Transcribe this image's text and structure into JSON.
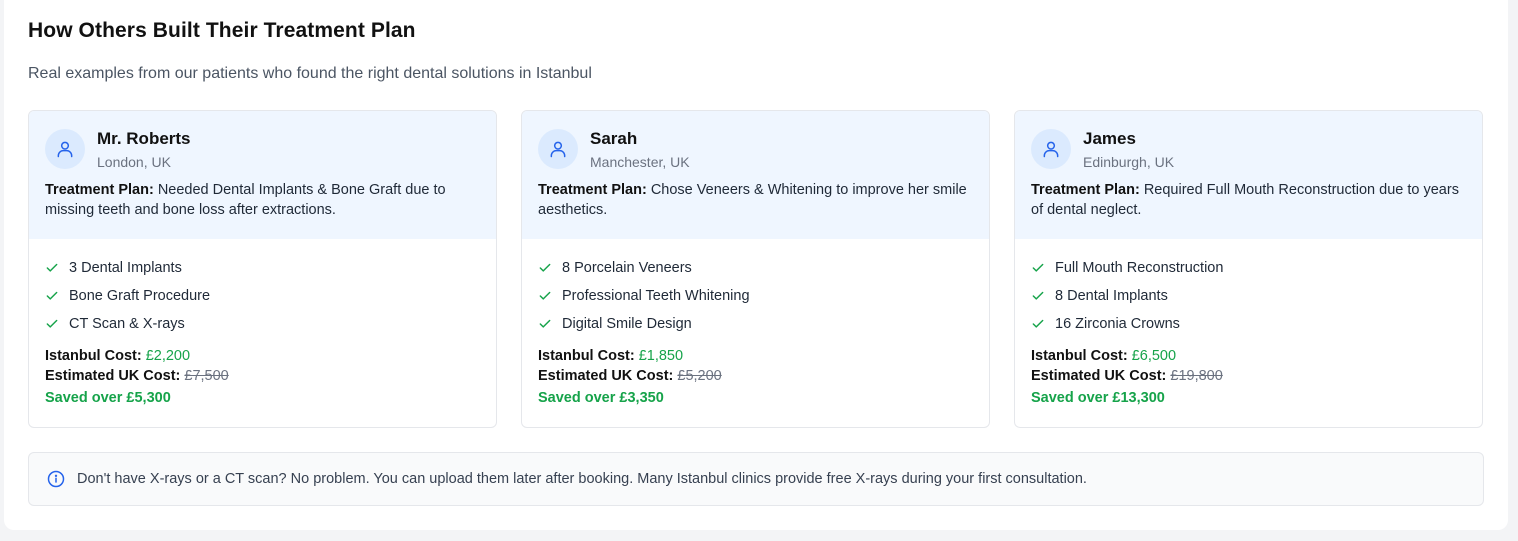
{
  "section": {
    "title": "How Others Built Their Treatment Plan",
    "subtitle": "Real examples from our patients who found the right dental solutions in Istanbul"
  },
  "labels": {
    "plan": "Treatment Plan:",
    "istanbul_cost": "Istanbul Cost:",
    "uk_cost": "Estimated UK Cost:"
  },
  "cards": [
    {
      "name": "Mr. Roberts",
      "location": "London, UK",
      "plan": "Needed Dental Implants & Bone Graft due to missing teeth and bone loss after extractions.",
      "items": [
        "3 Dental Implants",
        "Bone Graft Procedure",
        "CT Scan & X-rays"
      ],
      "istanbul_cost": "£2,200",
      "uk_cost": "£7,500",
      "saved": "Saved over £5,300"
    },
    {
      "name": "Sarah",
      "location": "Manchester, UK",
      "plan": "Chose Veneers & Whitening to improve her smile aesthetics.",
      "items": [
        "8 Porcelain Veneers",
        "Professional Teeth Whitening",
        "Digital Smile Design"
      ],
      "istanbul_cost": "£1,850",
      "uk_cost": "£5,200",
      "saved": "Saved over £3,350"
    },
    {
      "name": "James",
      "location": "Edinburgh, UK",
      "plan": "Required Full Mouth Reconstruction due to years of dental neglect.",
      "items": [
        "Full Mouth Reconstruction",
        "8 Dental Implants",
        "16 Zirconia Crowns"
      ],
      "istanbul_cost": "£6,500",
      "uk_cost": "£19,800",
      "saved": "Saved over £13,300"
    }
  ],
  "note": {
    "text": "Don't have X-rays or a CT scan? No problem. You can upload them later after booking. Many Istanbul clinics provide free X-rays during your first consultation.",
    "icon": "info-icon"
  },
  "colors": {
    "accent": "#2563eb",
    "success": "#16a34a",
    "card_header_bg": "#eff6ff"
  }
}
